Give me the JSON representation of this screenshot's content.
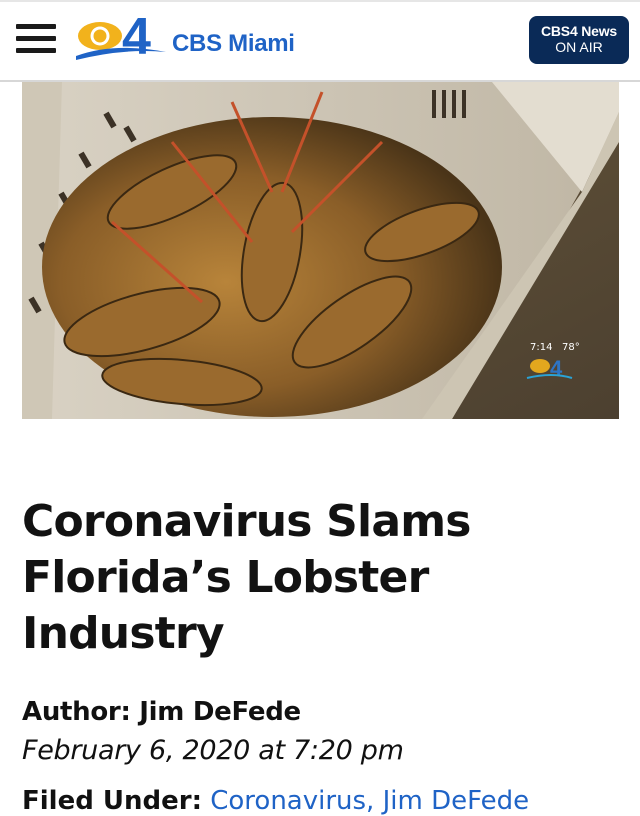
{
  "header": {
    "logo_number": "4",
    "brand": "CBS Miami",
    "live_button": {
      "line1": "CBS4 News",
      "line2": "ON AIR"
    }
  },
  "hero": {
    "overlay_time": "7:14",
    "overlay_temp": "78°",
    "overlay_logo": "4"
  },
  "article": {
    "headline": "Coronavirus Slams Florida’s Lobster Industry",
    "author": "Author: Jim DeFede",
    "date": "February 6, 2020 at 7:20 pm",
    "filed_label": "Filed Under:",
    "filed_value": "Coronavirus, Jim DeFede"
  },
  "colors": {
    "brand_blue": "#1f63c6",
    "logo_gold": "#f2b21c",
    "onair_navy": "#0a2a57"
  }
}
